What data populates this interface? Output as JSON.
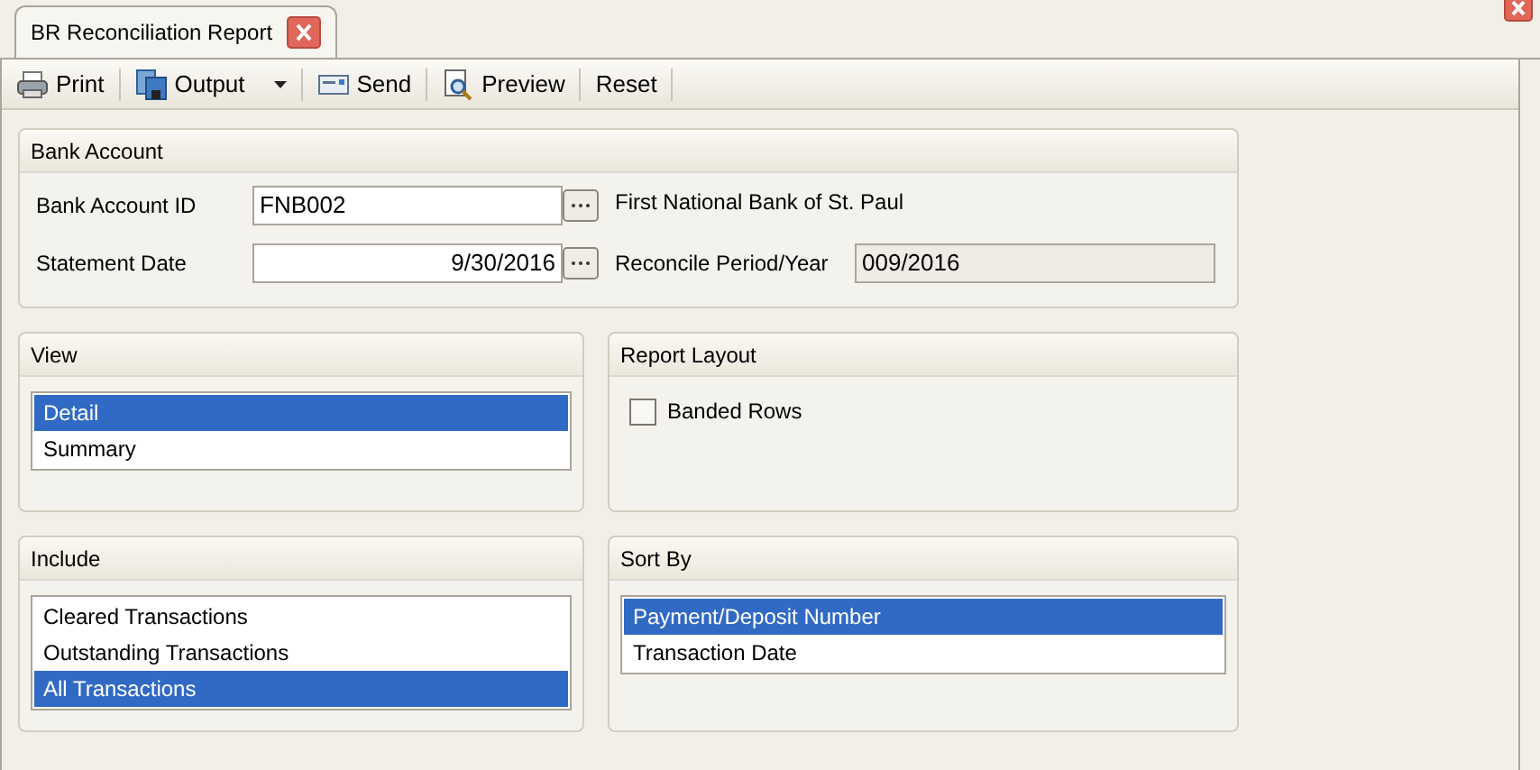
{
  "tab": {
    "title": "BR Reconciliation Report"
  },
  "toolbar": [
    {
      "label": "Print",
      "kind": "print"
    },
    {
      "label": "Output",
      "kind": "output"
    },
    {
      "label": "Send",
      "kind": "send"
    },
    {
      "label": "Preview",
      "kind": "preview"
    },
    {
      "label": "Reset",
      "kind": "plain"
    }
  ],
  "bank_account": {
    "title": "Bank Account",
    "account_id_label": "Bank Account ID",
    "account_id": "FNB002",
    "bank_name": "First National Bank of St. Paul",
    "statement_date_label": "Statement Date",
    "statement_date": "9/30/2016",
    "period_label": "Reconcile Period/Year",
    "period": "009/2016"
  },
  "view": {
    "title": "View",
    "items": [
      {
        "label": "Detail",
        "selected": true
      },
      {
        "label": "Summary",
        "selected": false
      }
    ]
  },
  "report_layout": {
    "title": "Report Layout",
    "banded_rows": {
      "label": "Banded Rows",
      "checked": false
    }
  },
  "include": {
    "title": "Include",
    "items": [
      {
        "label": "Cleared Transactions",
        "selected": false
      },
      {
        "label": "Outstanding Transactions",
        "selected": false
      },
      {
        "label": "All Transactions",
        "selected": true
      }
    ]
  },
  "sort_by": {
    "title": "Sort By",
    "items": [
      {
        "label": "Payment/Deposit Number",
        "selected": true
      },
      {
        "label": "Transaction Date",
        "selected": false
      }
    ]
  }
}
